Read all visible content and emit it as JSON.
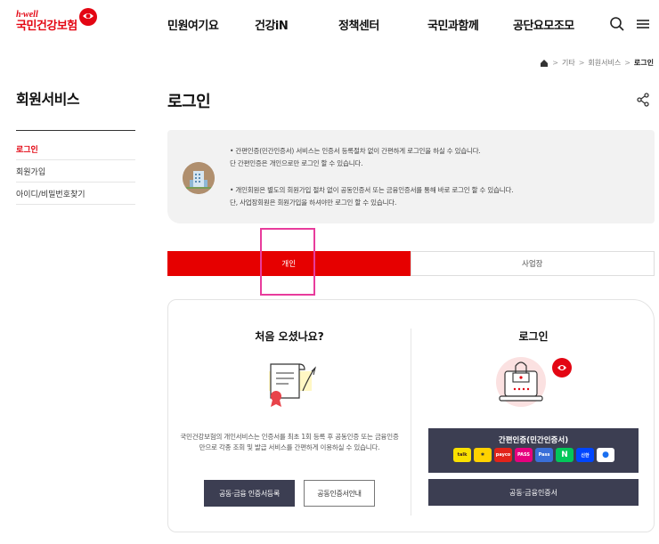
{
  "logo": {
    "small": "h·well",
    "main": "국민건강보험"
  },
  "nav": {
    "items": [
      "민원여기요",
      "건강iN",
      "정책센터",
      "국민과함께",
      "공단요모조모"
    ]
  },
  "header_icons": [
    "search-icon",
    "menu-icon"
  ],
  "breadcrumb": {
    "items": [
      "기타",
      "회원서비스",
      "로그인"
    ]
  },
  "sidebar": {
    "title": "회원서비스",
    "items": [
      "로그인",
      "회원가입",
      "아이디/비밀번호찾기"
    ],
    "active_index": 0
  },
  "page": {
    "title": "로그인"
  },
  "notice": {
    "lines": [
      "• 간편인증(민간인증서) 서비스는 인증서 등록절차 없이 간편하게 로그인을 하실 수 있습니다.",
      "단 간편인증은 개인으로만 로그인 할 수 있습니다.",
      "• 개인회원은 별도의 회원가입 절차 없이 공동인증서 또는 금융인증서를 통해 바로 로그인 할 수 있습니다.",
      "단, 사업장회원은 회원가입을 하셔야만 로그인 할 수 있습니다."
    ]
  },
  "tabs": [
    {
      "label": "개인",
      "active": true
    },
    {
      "label": "사업장",
      "active": false
    }
  ],
  "first_visit": {
    "title": "처음 오셨나요?",
    "description": "국민건강보험의 개인서비스는 인증서를 최초 1회 등록 후 공동인증 또는 금융인증만으로 각종 조회 및 발급 서비스를 간편하게 이용하실 수 있습니다.",
    "register_button": "공동·금융 인증서등록",
    "guide_button": "공동인증서안내"
  },
  "login": {
    "title": "로그인",
    "easy_auth_button": "간편인증(민간인증서)",
    "providers": [
      {
        "label": "talk",
        "bg": "#f9e000",
        "fg": "#3c1e1e"
      },
      {
        "label": "✱",
        "bg": "#ffd200",
        "fg": "#333333"
      },
      {
        "label": "payco",
        "bg": "#e2231a",
        "fg": "#ffffff"
      },
      {
        "label": "PASS",
        "bg": "#e6007e",
        "fg": "#ffffff"
      },
      {
        "label": "Pass",
        "bg": "#3a6fd8",
        "fg": "#ffffff"
      },
      {
        "label": "N",
        "bg": "#03c75a",
        "fg": "#ffffff"
      },
      {
        "label": "신한",
        "bg": "#0046ff",
        "fg": "#ffffff"
      },
      {
        "label": "●",
        "bg": "#ffffff",
        "fg": "#1a6ff0"
      }
    ],
    "cert_button": "공동·금융인증서"
  },
  "colors": {
    "brand": "#e30613",
    "tab_active": "#e60000",
    "button_dark": "#3c3e52",
    "highlight": "#e83c9c"
  }
}
